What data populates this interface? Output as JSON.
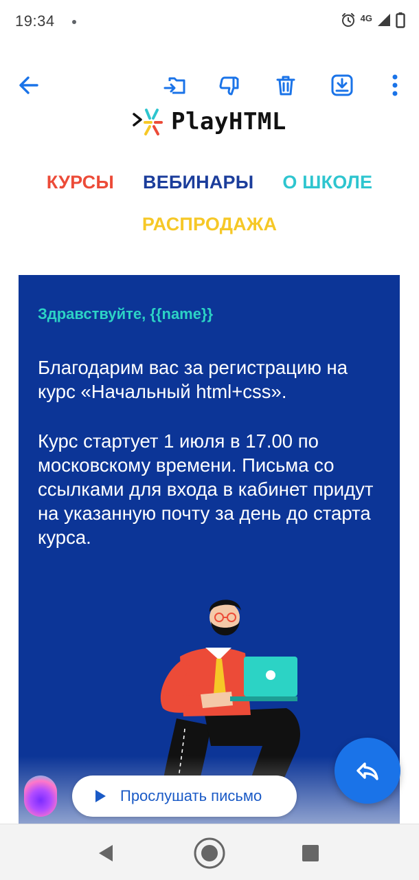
{
  "status_bar": {
    "time": "19:34",
    "network": "4G"
  },
  "toolbar": {
    "icons": [
      "back-arrow-icon",
      "move-to-folder-icon",
      "thumbs-down-icon",
      "trash-icon",
      "archive-icon",
      "more-vert-icon"
    ],
    "accent_color": "#1a73e8"
  },
  "email": {
    "logo_text": "PlayHTML",
    "nav": {
      "courses": "КУРСЫ",
      "webinars": "ВЕБИНАРЫ",
      "about": "О ШКОЛЕ",
      "sale": "РАСПРОДАЖА"
    },
    "nav_colors": {
      "courses": "#ec4b38",
      "webinars": "#1b3d9b",
      "about": "#2ec5cf",
      "sale": "#f6c827"
    },
    "card_color": "#0c3597",
    "greeting": "Здравствуйте, {{name}}",
    "paragraph1": "Благодарим вас за регистрацию на курс «Начальный html+css».",
    "paragraph2": "Курс стартует 1 июля в 17.00 по московскому времени. Письма со ссылками для входа в кабинет придут на указанную почту за день до старта курса."
  },
  "assistant": {
    "listen_label": "Прослушать письмо"
  },
  "fab": {
    "icon": "reply-icon"
  },
  "navbar": {
    "icons": [
      "back-triangle-icon",
      "home-circle-icon",
      "recents-square-icon"
    ]
  }
}
